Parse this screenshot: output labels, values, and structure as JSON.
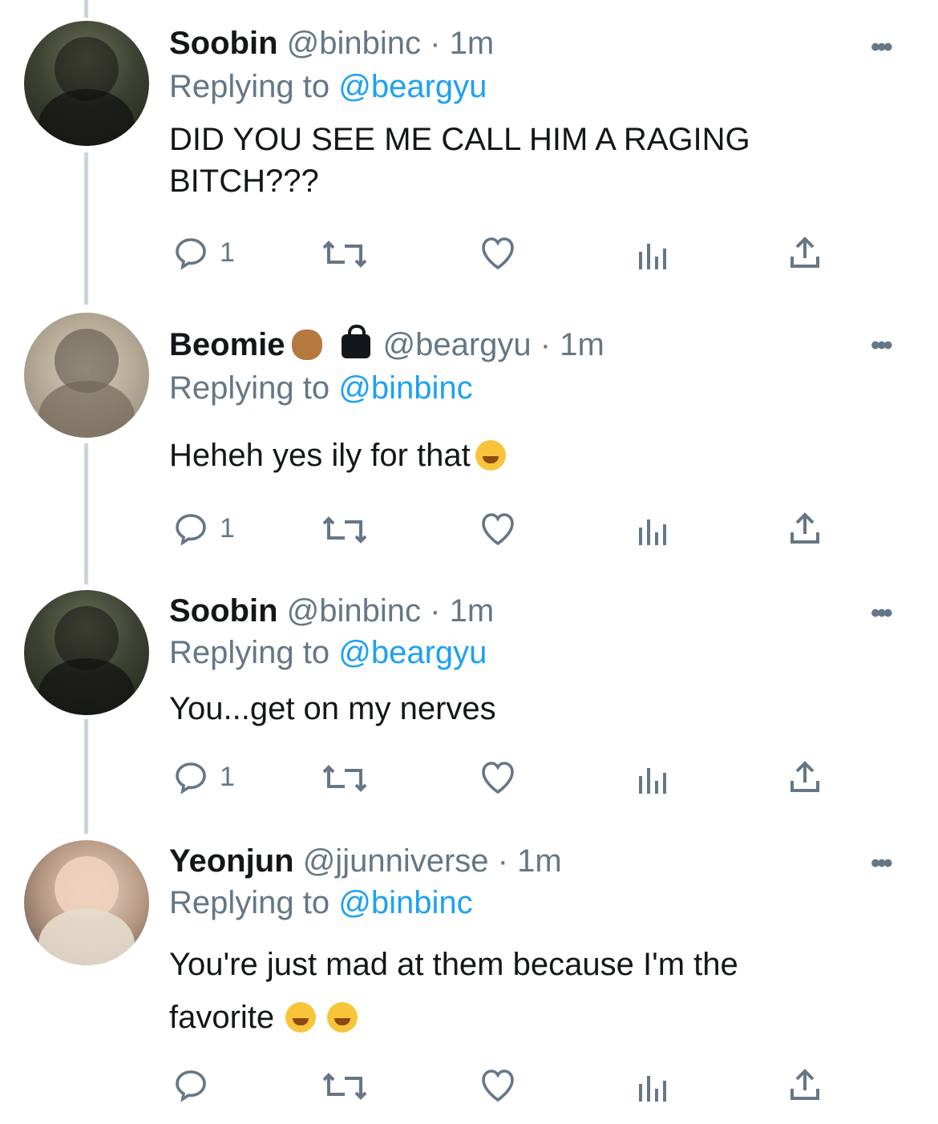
{
  "tweets": [
    {
      "name": "Soobin",
      "handle": "@binbinc",
      "time": "· 1m",
      "replying_prefix": "Replying to",
      "replying_to": "@beargyu",
      "text": "DID YOU SEE ME CALL HIM A RAGING BITCH???",
      "reply_count": "1",
      "avatar": "soobin-avatar"
    },
    {
      "name": "Beomie",
      "handle": "@beargyu",
      "time": "· 1m",
      "replying_prefix": "Replying to",
      "replying_to": "@binbinc",
      "text": "Heheh yes ily for that",
      "reply_count": "1",
      "avatar": "beomie-avatar"
    },
    {
      "name": "Soobin",
      "handle": "@binbinc",
      "time": "· 1m",
      "replying_prefix": "Replying to",
      "replying_to": "@beargyu",
      "text": "You...get on my nerves",
      "reply_count": "1",
      "avatar": "soobin-avatar"
    },
    {
      "name": "Yeonjun",
      "handle": "@jjunniverse",
      "time": "· 1m",
      "replying_prefix": "Replying to",
      "replying_to": "@binbinc",
      "text_line1": "You're just mad at them because I'm the",
      "text_line2": "favorite",
      "reply_count": "",
      "avatar": "yeonjun-avatar"
    }
  ],
  "icons": [
    "reply-icon",
    "retweet-icon",
    "like-icon",
    "analytics-icon",
    "share-icon",
    "more-icon"
  ],
  "colors": {
    "accent": "#1da1f2",
    "muted": "#657786",
    "text": "#14171a",
    "thread_line": "#ccd6dd"
  }
}
